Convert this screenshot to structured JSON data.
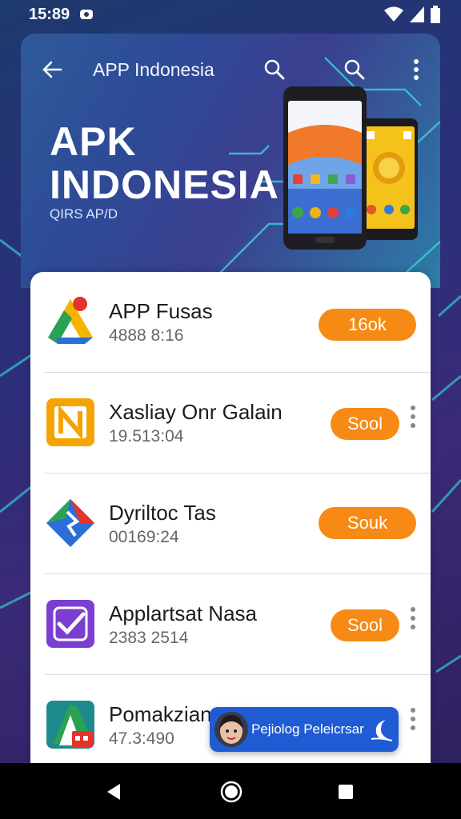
{
  "status_bar": {
    "time": "15:89",
    "icons": [
      "cloud-icon",
      "wifi-icon",
      "signal-icon",
      "battery-icon"
    ]
  },
  "app_bar": {
    "title": "APP Indonesia",
    "icons": [
      "back-arrow-icon",
      "search-icon",
      "search-icon",
      "more-vert-icon"
    ]
  },
  "hero": {
    "title_line1": "APK",
    "title_line2": "INDONESIA",
    "subtitle": "QIRS AP/D"
  },
  "apps": [
    {
      "name": "APP Fusas",
      "meta": "4888 8:16",
      "button": "16ok",
      "icon": "drive-icon",
      "has_menu": false
    },
    {
      "name": "Xasliay Onr Galain",
      "meta": "19.513:04",
      "button": "Sool",
      "icon": "n-letter-icon",
      "has_menu": true
    },
    {
      "name": "Dyriltoc Tas",
      "meta": "00169:24",
      "button": "Souk",
      "icon": "maps-pin-icon",
      "has_menu": false
    },
    {
      "name": "Applartsat Nasa",
      "meta": "2383 2514",
      "button": "Sool",
      "icon": "checkmark-icon",
      "has_menu": true
    },
    {
      "name": "Pomakzian",
      "meta": "47.3:490",
      "button": "",
      "icon": "a-letter-icon",
      "has_menu": true
    }
  ],
  "toast": {
    "text": "Pejiolog Peleicrsar",
    "icon": "moon-icon"
  },
  "nav_bar": {
    "icons": [
      "nav-back-icon",
      "nav-home-icon",
      "nav-recents-icon"
    ]
  },
  "colors": {
    "accent_orange": "#f78a14",
    "toast_blue": "#1f5bd3"
  }
}
